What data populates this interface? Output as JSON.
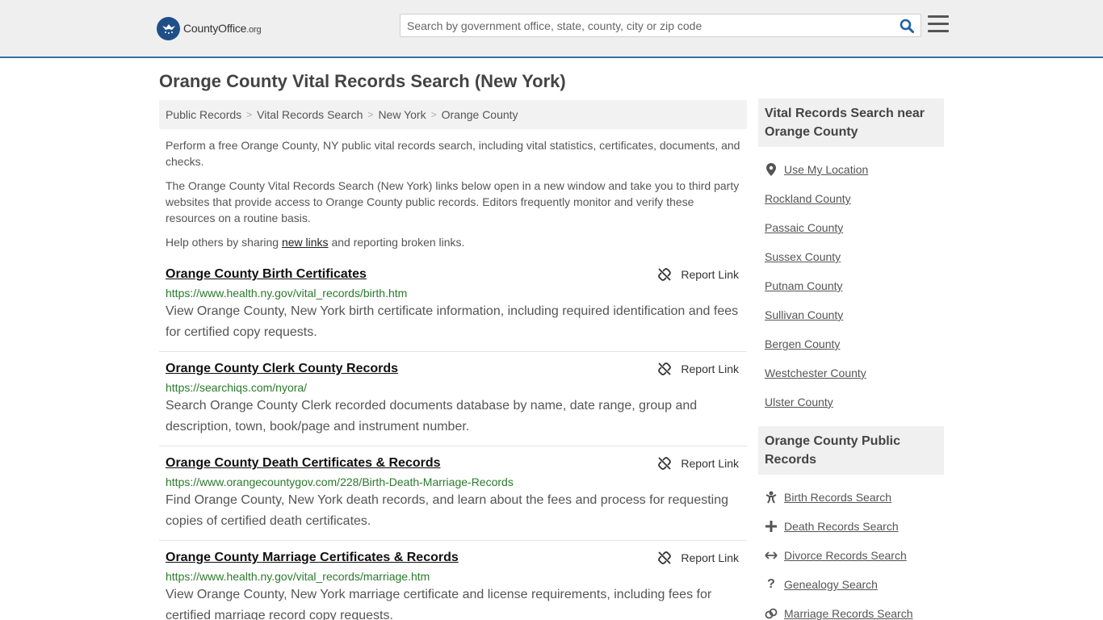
{
  "header": {
    "logo_text": "CountyOffice",
    "logo_suffix": ".org",
    "search_placeholder": "Search by government office, state, county, city or zip code"
  },
  "page_title": "Orange County Vital Records Search (New York)",
  "breadcrumb": [
    "Public Records",
    "Vital Records Search",
    "New York",
    "Orange County"
  ],
  "intro": {
    "p1": "Perform a free Orange County, NY public vital records search, including vital statistics, certificates, documents, and checks.",
    "p2": "The Orange County Vital Records Search (New York) links below open in a new window and take you to third party websites that provide access to Orange County public records. Editors frequently monitor and verify these resources on a routine basis.",
    "p3_before": "Help others by sharing ",
    "p3_link": "new links",
    "p3_after": " and reporting broken links."
  },
  "report_label": "Report Link",
  "listings": [
    {
      "title": "Orange County Birth Certificates",
      "url": "https://www.health.ny.gov/vital_records/birth.htm",
      "description": "View Orange County, New York birth certificate information, including required identification and fees for certified copy requests."
    },
    {
      "title": "Orange County Clerk County Records",
      "url": "https://searchiqs.com/nyora/",
      "description": "Search Orange County Clerk recorded documents database by name, date range, group and description, town, book/page and instrument number."
    },
    {
      "title": "Orange County Death Certificates & Records",
      "url": "https://www.orangecountygov.com/228/Birth-Death-Marriage-Records",
      "description": "Find Orange County, New York death records, and learn about the fees and process for requesting copies of certified death certificates."
    },
    {
      "title": "Orange County Marriage Certificates & Records",
      "url": "https://www.health.ny.gov/vital_records/marriage.htm",
      "description": "View Orange County, New York marriage certificate and license requirements, including fees for certified marriage record copy requests."
    }
  ],
  "sidebar": {
    "nearby_heading": "Vital Records Search near Orange County",
    "use_location": "Use My Location",
    "nearby": [
      "Rockland County",
      "Passaic County",
      "Sussex County",
      "Putnam County",
      "Sullivan County",
      "Bergen County",
      "Westchester County",
      "Ulster County"
    ],
    "public_heading": "Orange County Public Records",
    "public_links": [
      {
        "label": "Birth Records Search",
        "icon": "baby-icon"
      },
      {
        "label": "Death Records Search",
        "icon": "cross-icon"
      },
      {
        "label": "Divorce Records Search",
        "icon": "arrows-horizontal-icon"
      },
      {
        "label": "Genealogy Search",
        "icon": "question-icon"
      },
      {
        "label": "Marriage Records Search",
        "icon": "rings-icon"
      }
    ]
  },
  "colors": {
    "accent_border": "#3a6ea8",
    "logo_blue": "#1f4f87",
    "url_green": "#2a7a2a",
    "search_icon_blue": "#1f5fa8"
  }
}
